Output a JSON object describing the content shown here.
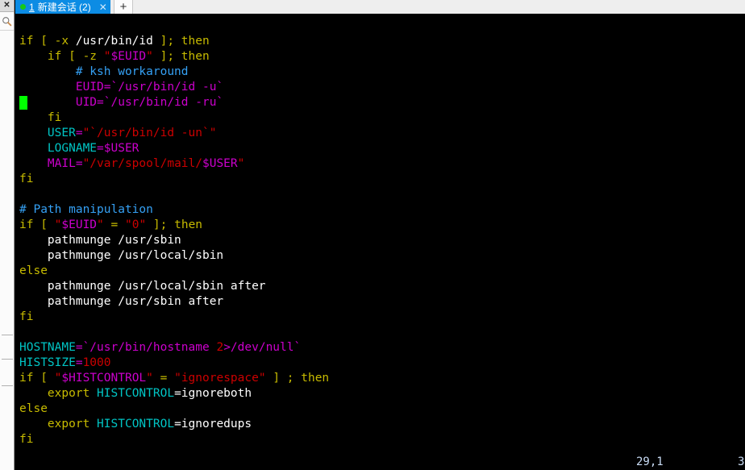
{
  "window": {
    "app_kind": "terminal-emulator"
  },
  "sidebar": {
    "close_label": "✕",
    "search_icon": "search-icon",
    "dividers": 3
  },
  "tabbar": {
    "active_tab": {
      "number": "1",
      "title": "新建会话 (2)",
      "close_label": "✕",
      "status_dot_color": "#17c917",
      "background": "#0c8ce4"
    },
    "new_tab_label": "+"
  },
  "terminal": {
    "background": "#000000",
    "cursor": {
      "color": "#00ff00",
      "line_index": 4,
      "column": 0
    },
    "colors": {
      "keyword": "#c7bb00",
      "plain": "#ffffff",
      "comment": "#2a7fff",
      "variable": "#cc00cc",
      "identifier": "#00c5c5",
      "string": "#cc0000"
    },
    "lines": [
      [
        {
          "t": "if [ -x ",
          "c": "kw"
        },
        {
          "t": "/usr/bin/id",
          "c": "pl"
        },
        {
          "t": " ]; then",
          "c": "kw"
        }
      ],
      [
        {
          "t": "    if [ -z ",
          "c": "kw"
        },
        {
          "t": "\"",
          "c": "st"
        },
        {
          "t": "$EUID",
          "c": "vr"
        },
        {
          "t": "\"",
          "c": "st"
        },
        {
          "t": " ]; then",
          "c": "kw"
        }
      ],
      [
        {
          "t": "        ",
          "c": "pl"
        },
        {
          "t": "# ksh workaround",
          "c": "cm2"
        }
      ],
      [
        {
          "t": "        EUID=`/usr/bin/id -u`",
          "c": "vr"
        }
      ],
      [
        {
          "t": "        UID=`/usr/bin/id -ru`",
          "c": "vr"
        }
      ],
      [
        {
          "t": "    ",
          "c": "pl"
        },
        {
          "t": "fi",
          "c": "kw"
        }
      ],
      [
        {
          "t": "    ",
          "c": "pl"
        },
        {
          "t": "USER",
          "c": "id"
        },
        {
          "t": "=",
          "c": "vr"
        },
        {
          "t": "\"`/usr/bin/id -un`\"",
          "c": "st"
        }
      ],
      [
        {
          "t": "    ",
          "c": "pl"
        },
        {
          "t": "LOGNAME",
          "c": "id"
        },
        {
          "t": "=",
          "c": "vr"
        },
        {
          "t": "$USER",
          "c": "vr"
        }
      ],
      [
        {
          "t": "    ",
          "c": "pl"
        },
        {
          "t": "MAIL",
          "c": "vr"
        },
        {
          "t": "=",
          "c": "vr"
        },
        {
          "t": "\"/var/spool/mail/",
          "c": "st"
        },
        {
          "t": "$USER",
          "c": "vr"
        },
        {
          "t": "\"",
          "c": "st"
        }
      ],
      [
        {
          "t": "fi",
          "c": "kw"
        }
      ],
      [
        {
          "t": "",
          "c": "pl"
        }
      ],
      [
        {
          "t": "# Path manipulation",
          "c": "cm2"
        }
      ],
      [
        {
          "t": "if [ ",
          "c": "kw"
        },
        {
          "t": "\"",
          "c": "st"
        },
        {
          "t": "$EUID",
          "c": "vr"
        },
        {
          "t": "\"",
          "c": "st"
        },
        {
          "t": " = ",
          "c": "kw"
        },
        {
          "t": "\"0\"",
          "c": "st"
        },
        {
          "t": " ]; then",
          "c": "kw"
        }
      ],
      [
        {
          "t": "    pathmunge /usr/sbin",
          "c": "pl"
        }
      ],
      [
        {
          "t": "    pathmunge /usr/local/sbin",
          "c": "pl"
        }
      ],
      [
        {
          "t": "else",
          "c": "kw"
        }
      ],
      [
        {
          "t": "    pathmunge /usr/local/sbin after",
          "c": "pl"
        }
      ],
      [
        {
          "t": "    pathmunge /usr/sbin after",
          "c": "pl"
        }
      ],
      [
        {
          "t": "fi",
          "c": "kw"
        }
      ],
      [
        {
          "t": "",
          "c": "pl"
        }
      ],
      [
        {
          "t": "HOSTNAME",
          "c": "id"
        },
        {
          "t": "=`/usr/bin/hostname ",
          "c": "vr"
        },
        {
          "t": "2",
          "c": "st"
        },
        {
          "t": ">/dev/null`",
          "c": "vr"
        }
      ],
      [
        {
          "t": "HISTSIZE",
          "c": "id"
        },
        {
          "t": "=",
          "c": "vr"
        },
        {
          "t": "1000",
          "c": "st"
        }
      ],
      [
        {
          "t": "if [ ",
          "c": "kw"
        },
        {
          "t": "\"",
          "c": "st"
        },
        {
          "t": "$HISTCONTROL",
          "c": "vr"
        },
        {
          "t": "\"",
          "c": "st"
        },
        {
          "t": " = ",
          "c": "kw"
        },
        {
          "t": "\"ignorespace\"",
          "c": "st"
        },
        {
          "t": " ] ; then",
          "c": "kw"
        }
      ],
      [
        {
          "t": "    ",
          "c": "pl"
        },
        {
          "t": "export",
          "c": "kw"
        },
        {
          "t": " ",
          "c": "pl"
        },
        {
          "t": "HISTCONTROL",
          "c": "id"
        },
        {
          "t": "=ignoreboth",
          "c": "pl"
        }
      ],
      [
        {
          "t": "else",
          "c": "kw"
        }
      ],
      [
        {
          "t": "    ",
          "c": "pl"
        },
        {
          "t": "export",
          "c": "kw"
        },
        {
          "t": " ",
          "c": "pl"
        },
        {
          "t": "HISTCONTROL",
          "c": "id"
        },
        {
          "t": "=ignoredups",
          "c": "pl"
        }
      ],
      [
        {
          "t": "fi",
          "c": "kw"
        }
      ]
    ]
  },
  "statusline": {
    "cursor_position": "29,1",
    "scroll_percent": "3"
  }
}
